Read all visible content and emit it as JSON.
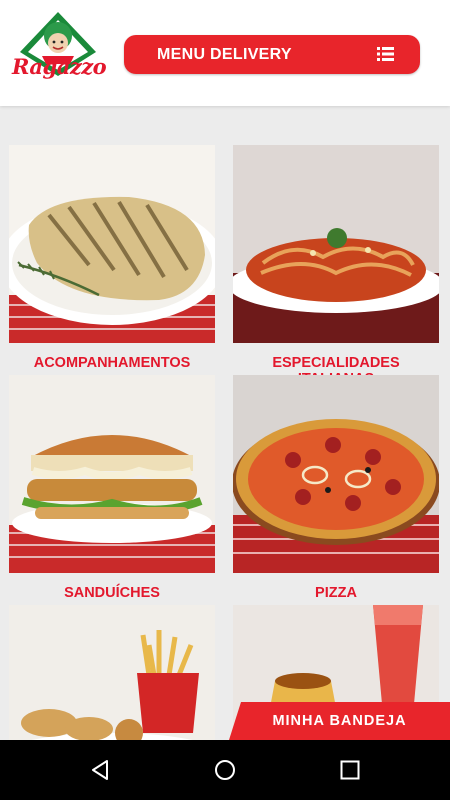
{
  "brand": {
    "logo_text": "Ragazzo",
    "accent": "#e8252b",
    "label_color": "#e3182d"
  },
  "header": {
    "menu_button_label": "MENU DELIVERY",
    "menu_icon": "list-icon"
  },
  "categories": [
    {
      "label": "ACOMPANHAMENTOS",
      "image": "grilled-chicken-breast"
    },
    {
      "label": "ESPECIALIDADES ITALIANAS",
      "image": "pasta-with-sauce"
    },
    {
      "label": "SANDUÍCHES",
      "image": "breaded-sandwich"
    },
    {
      "label": "PIZZA",
      "image": "pepperoni-onion-pizza"
    },
    {
      "label": "",
      "image": "fries-and-croquettes"
    },
    {
      "label": "",
      "image": "dessert-and-drink"
    }
  ],
  "tray_button": {
    "label": "MINHA BANDEJA"
  },
  "navbar": {
    "back_icon": "back-icon",
    "home_icon": "home-icon",
    "recents_icon": "recents-icon"
  }
}
